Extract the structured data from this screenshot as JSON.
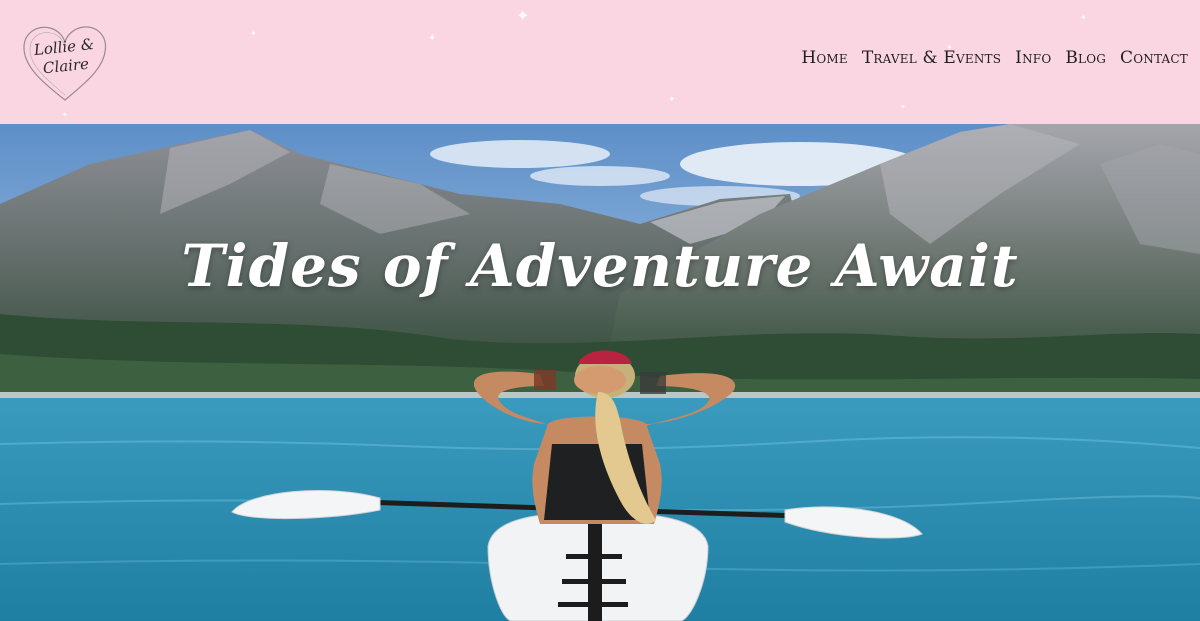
{
  "logo": {
    "line1": "Lollie &",
    "line2": "Claire"
  },
  "nav": {
    "items": [
      {
        "label": "Home"
      },
      {
        "label": "Travel & Events"
      },
      {
        "label": "Info"
      },
      {
        "label": "Blog"
      },
      {
        "label": "Contact"
      }
    ]
  },
  "hero": {
    "title": "Tides of Adventure Await"
  },
  "colors": {
    "header_bg": "#f9d6e2",
    "nav_text": "#1f1f1f",
    "lake": "#2c8db0",
    "sky": "#6f9fd0"
  }
}
